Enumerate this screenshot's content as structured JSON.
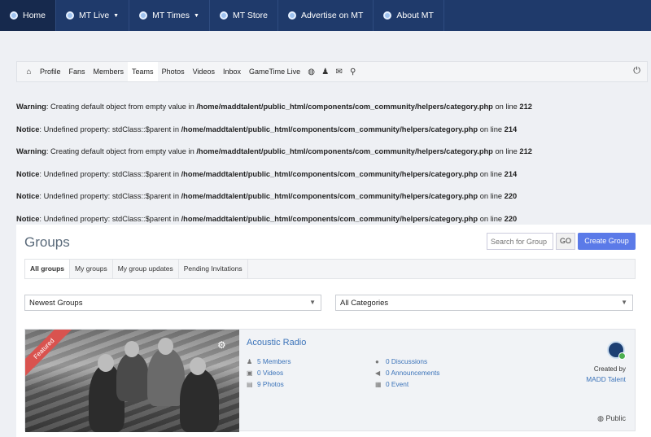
{
  "topnav": {
    "items": [
      {
        "label": "Home",
        "caret": ""
      },
      {
        "label": "MT Live",
        "caret": "▼"
      },
      {
        "label": "MT Times",
        "caret": "▼"
      },
      {
        "label": "MT Store",
        "caret": ""
      },
      {
        "label": "Advertise on MT",
        "caret": ""
      },
      {
        "label": "About MT",
        "caret": ""
      }
    ]
  },
  "toolbar": {
    "items": [
      "Profile",
      "Fans",
      "Members",
      "Teams",
      "Photos",
      "Videos",
      "Inbox",
      "GameTime Live"
    ],
    "icons": [
      "home-icon",
      "globe-icon",
      "user-add-icon",
      "mail-icon",
      "search-icon",
      "power-icon"
    ]
  },
  "messages": [
    {
      "type": "Warning",
      "text": ": Creating default object from empty value in ",
      "path": "/home/maddtalent/public_html/components/com_community/helpers/category.php",
      "on": " on line ",
      "line": "212"
    },
    {
      "type": "Notice",
      "text": ": Undefined property: stdClass::$parent in ",
      "path": "/home/maddtalent/public_html/components/com_community/helpers/category.php",
      "on": " on line ",
      "line": "214"
    },
    {
      "type": "Warning",
      "text": ": Creating default object from empty value in ",
      "path": "/home/maddtalent/public_html/components/com_community/helpers/category.php",
      "on": " on line ",
      "line": "212"
    },
    {
      "type": "Notice",
      "text": ": Undefined property: stdClass::$parent in ",
      "path": "/home/maddtalent/public_html/components/com_community/helpers/category.php",
      "on": " on line ",
      "line": "214"
    },
    {
      "type": "Notice",
      "text": ": Undefined property: stdClass::$parent in ",
      "path": "/home/maddtalent/public_html/components/com_community/helpers/category.php",
      "on": " on line ",
      "line": "220"
    },
    {
      "type": "Notice",
      "text": ": Undefined property: stdClass::$parent in ",
      "path": "/home/maddtalent/public_html/components/com_community/helpers/category.php",
      "on": " on line ",
      "line": "220"
    }
  ],
  "groups": {
    "title": "Groups",
    "search_placeholder": "Search for Group",
    "go_label": "GO",
    "create_label": "Create Group",
    "tabs": [
      "All groups",
      "My groups",
      "My group updates",
      "Pending Invitations"
    ],
    "sort_select": "Newest Groups",
    "category_select": "All Categories"
  },
  "group_card": {
    "ribbon": "Featured",
    "name": "Acoustic Radio",
    "members": "5 Members",
    "videos": "0 Videos",
    "photos": "9 Photos",
    "discussions": "0 Discussions",
    "announcements": "0 Announcements",
    "events": "0 Event",
    "created_by_label": "Created by",
    "creator": "MADD Talent",
    "privacy": "Public"
  },
  "colors": {
    "nav_bg": "#1f3a6b",
    "link": "#3b73b9",
    "create_button": "#5b7ae8",
    "ribbon": "#d9534f"
  }
}
